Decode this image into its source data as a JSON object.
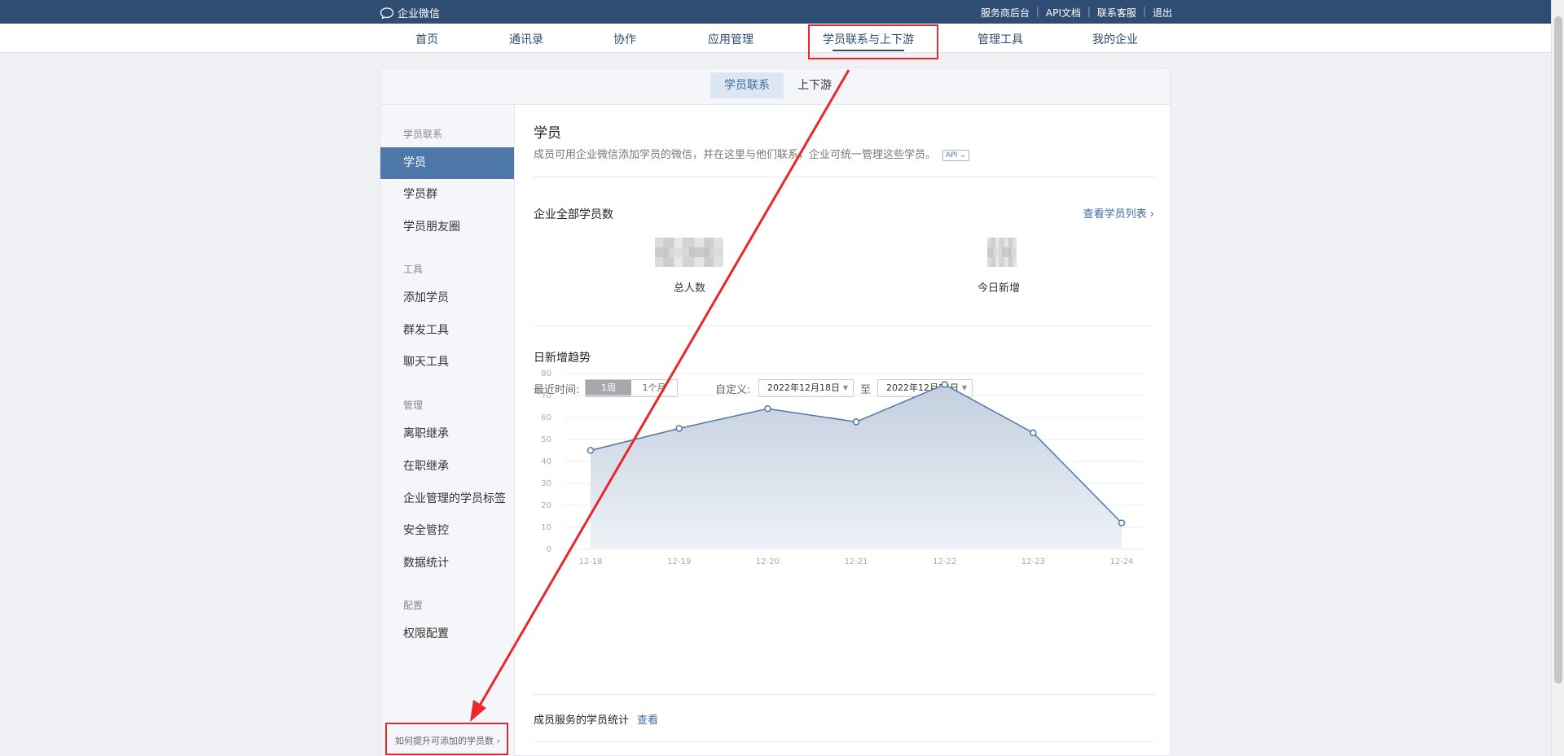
{
  "topbar": {
    "logo_text": "企业微信",
    "links": [
      "服务商后台",
      "API文档",
      "联系客服",
      "退出"
    ]
  },
  "mainnav": {
    "items": [
      "首页",
      "通讯录",
      "协作",
      "应用管理",
      "学员联系与上下游",
      "管理工具",
      "我的企业"
    ],
    "active": "学员联系与上下游"
  },
  "subtabs": [
    "学员联系",
    "上下游"
  ],
  "sidebar": {
    "groups": [
      {
        "label": "学员联系",
        "items": [
          "学员",
          "学员群",
          "学员朋友圈"
        ]
      },
      {
        "label": "工具",
        "items": [
          "添加学员",
          "群发工具",
          "聊天工具"
        ]
      },
      {
        "label": "管理",
        "items": [
          "离职继承",
          "在职继承",
          "企业管理的学员标签",
          "安全管控",
          "数据统计"
        ]
      },
      {
        "label": "配置",
        "items": [
          "权限配置"
        ]
      }
    ],
    "active_item": "学员",
    "footer_link": "如何提升可添加的学员数"
  },
  "content": {
    "title": "学员",
    "description": "成员可用企业微信添加学员的微信，并在这里与他们联系，企业可统一管理这些学员。",
    "api_badge": "API",
    "total_section_title": "企业全部学员数",
    "view_list_link": "查看学员列表 ›",
    "stats": [
      {
        "label": "总人数",
        "value_hidden": true
      },
      {
        "label": "今日新增",
        "value_hidden": true
      }
    ],
    "trend_title": "日新增趋势",
    "filter_label": "最近时间:",
    "range_options": [
      "1周",
      "1个月"
    ],
    "range_selected": "1周",
    "custom_label": "自定义:",
    "date_from": "2022年12月18日",
    "date_to": "2022年12月24日",
    "date_sep": "至",
    "service_stats_title": "成员服务的学员统计",
    "service_stats_link": "查看"
  },
  "chart_data": {
    "type": "area",
    "categories": [
      "12-18",
      "12-19",
      "12-20",
      "12-21",
      "12-22",
      "12-23",
      "12-24"
    ],
    "values": [
      45,
      55,
      64,
      58,
      75,
      53,
      12
    ],
    "ylim": [
      0,
      80
    ],
    "yticks": [
      0,
      10,
      20,
      30,
      40,
      50,
      60,
      70,
      80
    ],
    "grid": true,
    "line_color": "#4f78aa"
  },
  "colors": {
    "topbar": "#2f4d73",
    "sidebar_active": "#4f78aa",
    "annotation": "#e8282b"
  }
}
